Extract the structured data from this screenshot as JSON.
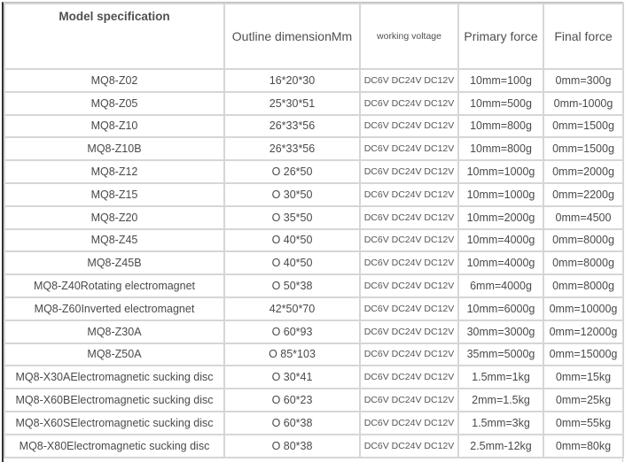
{
  "headers": {
    "model": "Model specification",
    "dimension": "Outline dimensionMm",
    "voltage": "working voltage",
    "primary": "Primary force",
    "final": "Final force"
  },
  "rows": [
    {
      "model": "MQ8-Z02",
      "dimension": "16*20*30",
      "voltage": "DC6V DC24V DC12V",
      "primary": "10mm=100g",
      "final": "0mm=300g"
    },
    {
      "model": "MQ8-Z05",
      "dimension": "25*30*51",
      "voltage": "DC6V DC24V DC12V",
      "primary": "10mm=500g",
      "final": "0mm-1000g"
    },
    {
      "model": "MQ8-Z10",
      "dimension": "26*33*56",
      "voltage": "DC6V DC24V DC12V",
      "primary": "10mm=800g",
      "final": "0mm=1500g"
    },
    {
      "model": "MQ8-Z10B",
      "dimension": "26*33*56",
      "voltage": "DC6V DC24V DC12V",
      "primary": "10mm=800g",
      "final": "0mm=1500g"
    },
    {
      "model": "MQ8-Z12",
      "dimension": "O 26*50",
      "voltage": "DC6V DC24V DC12V",
      "primary": "10mm=1000g",
      "final": "0mm=2000g"
    },
    {
      "model": "MQ8-Z15",
      "dimension": "O 30*50",
      "voltage": "DC6V DC24V DC12V",
      "primary": "10mm=1000g",
      "final": "0mm=2200g"
    },
    {
      "model": "MQ8-Z20",
      "dimension": "O 35*50",
      "voltage": "DC6V DC24V DC12V",
      "primary": "10mm=2000g",
      "final": "0mm=4500"
    },
    {
      "model": "MQ8-Z45",
      "dimension": "O 40*50",
      "voltage": "DC6V DC24V DC12V",
      "primary": "10mm=4000g",
      "final": "0mm=8000g"
    },
    {
      "model": "MQ8-Z45B",
      "dimension": "O 40*50",
      "voltage": "DC6V DC24V DC12V",
      "primary": "10mm=4000g",
      "final": "0mm=8000g"
    },
    {
      "model": "MQ8-Z40Rotating electromagnet",
      "dimension": "O 50*38",
      "voltage": "DC6V DC24V DC12V",
      "primary": "6mm=4000g",
      "final": "0mm=8000g"
    },
    {
      "model": "MQ8-Z60Inverted electromagnet",
      "dimension": "42*50*70",
      "voltage": "DC6V DC24V DC12V",
      "primary": "10mm=6000g",
      "final": "0mm=10000g"
    },
    {
      "model": "MQ8-Z30A",
      "dimension": "O 60*93",
      "voltage": "DC6V DC24V DC12V",
      "primary": "30mm=3000g",
      "final": "0mm=12000g"
    },
    {
      "model": "MQ8-Z50A",
      "dimension": "O 85*103",
      "voltage": "DC6V DC24V DC12V",
      "primary": "35mm=5000g",
      "final": "0mm=15000g"
    },
    {
      "model": "MQ8-X30AElectromagnetic sucking disc",
      "dimension": "O 30*41",
      "voltage": "DC6V DC24V DC12V",
      "primary": "1.5mm=1kg",
      "final": "0mm=15kg"
    },
    {
      "model": "MQ8-X60BElectromagnetic sucking disc",
      "dimension": "O 60*23",
      "voltage": "DC6V DC24V DC12V",
      "primary": "2mm=1.5kg",
      "final": "0mm=25kg"
    },
    {
      "model": "MQ8-X60SElectromagnetic sucking disc",
      "dimension": "O 60*38",
      "voltage": "DC6V DC24V DC12V",
      "primary": "1.5mm=3kg",
      "final": "0mm=55kg"
    },
    {
      "model": "MQ8-X80Electromagnetic sucking disc",
      "dimension": "O 80*38",
      "voltage": "DC6V DC24V DC12V",
      "primary": "2.5mm-12kg",
      "final": "0mm=80kg"
    }
  ]
}
